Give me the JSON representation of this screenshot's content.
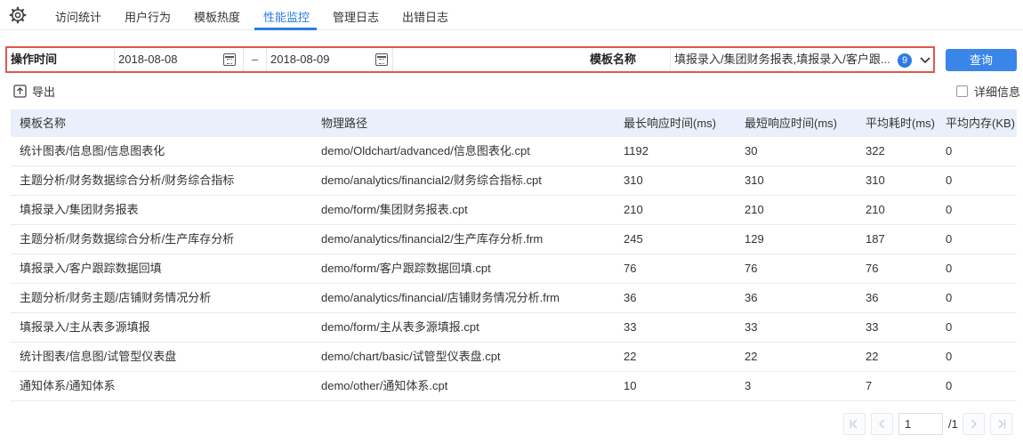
{
  "nav": {
    "tabs": [
      "访问统计",
      "用户行为",
      "模板热度",
      "性能监控",
      "管理日志",
      "出错日志"
    ],
    "active_tab": "性能监控"
  },
  "filter": {
    "time_label": "操作时间",
    "start_date": "2018-08-08",
    "separator": "–",
    "end_date": "2018-08-09",
    "template_label": "模板名称",
    "template_value": "填报录入/集团财务报表,填报录入/客户跟...",
    "selected_count": "9",
    "query_label": "查询"
  },
  "actions": {
    "export_label": "导出",
    "detail_label": "详细信息",
    "detail_checked": false
  },
  "table": {
    "headers": [
      "模板名称",
      "物理路径",
      "最长响应时间(ms)",
      "最短响应时间(ms)",
      "平均耗时(ms)",
      "平均内存(KB)"
    ],
    "rows": [
      [
        "统计图表/信息图/信息图表化",
        "demo/Oldchart/advanced/信息图表化.cpt",
        "1192",
        "30",
        "322",
        "0"
      ],
      [
        "主题分析/财务数据综合分析/财务综合指标",
        "demo/analytics/financial2/财务综合指标.cpt",
        "310",
        "310",
        "310",
        "0"
      ],
      [
        "填报录入/集团财务报表",
        "demo/form/集团财务报表.cpt",
        "210",
        "210",
        "210",
        "0"
      ],
      [
        "主题分析/财务数据综合分析/生产库存分析",
        "demo/analytics/financial2/生产库存分析.frm",
        "245",
        "129",
        "187",
        "0"
      ],
      [
        "填报录入/客户跟踪数据回填",
        "demo/form/客户跟踪数据回填.cpt",
        "76",
        "76",
        "76",
        "0"
      ],
      [
        "主题分析/财务主题/店铺财务情况分析",
        "demo/analytics/financial/店铺财务情况分析.frm",
        "36",
        "36",
        "36",
        "0"
      ],
      [
        "填报录入/主从表多源填报",
        "demo/form/主从表多源填报.cpt",
        "33",
        "33",
        "33",
        "0"
      ],
      [
        "统计图表/信息图/试管型仪表盘",
        "demo/chart/basic/试管型仪表盘.cpt",
        "22",
        "22",
        "22",
        "0"
      ],
      [
        "通知体系/通知体系",
        "demo/other/通知体系.cpt",
        "10",
        "3",
        "7",
        "0"
      ]
    ]
  },
  "pagination": {
    "current_page": "1",
    "total_label": "/1"
  },
  "colors": {
    "accent": "#2c7be5",
    "highlight_border": "#e0584f",
    "header_bg": "#e9f0fb"
  }
}
